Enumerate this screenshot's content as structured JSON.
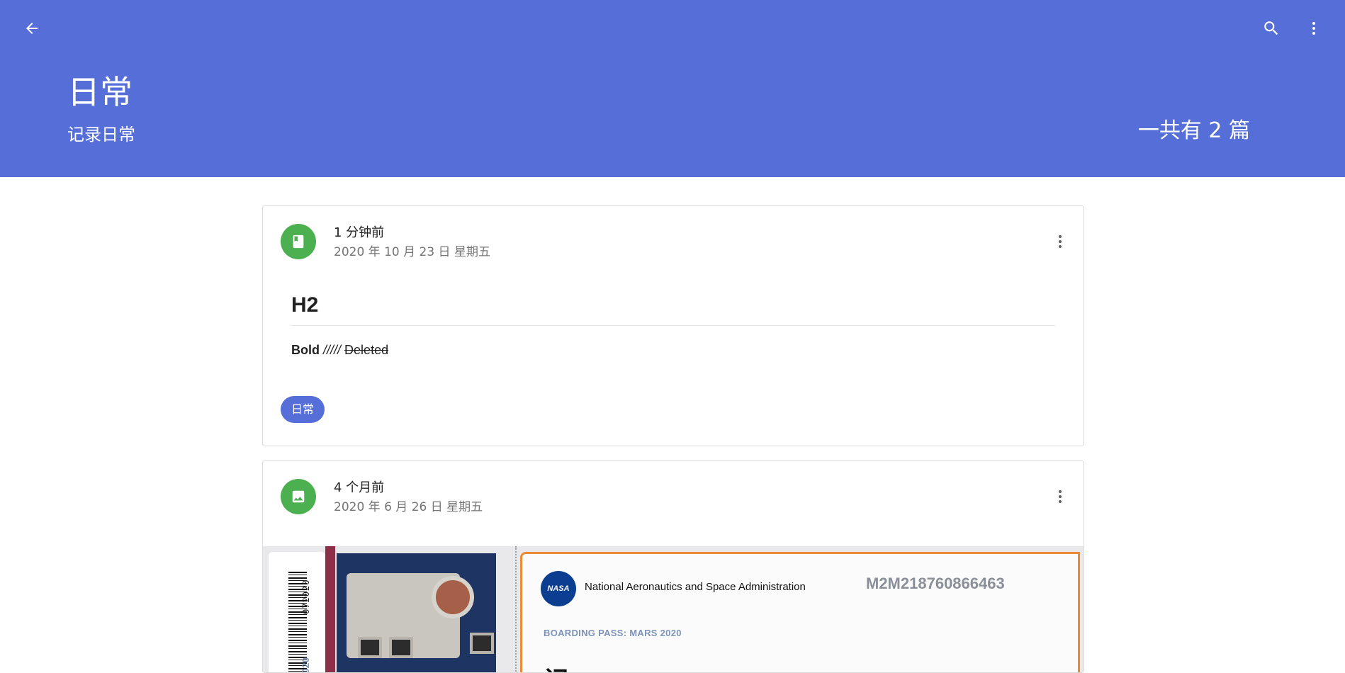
{
  "appbar": {
    "back_icon": "arrow-back-icon",
    "search_icon": "search-icon",
    "more_icon": "more-vert-icon",
    "title": "日常",
    "subtitle": "记录日常",
    "count_label": "一共有 2 篇",
    "color": "#566ed8"
  },
  "posts": [
    {
      "type_icon": "book-icon",
      "relative_time": "1 分钟前",
      "date": "2020 年 10 月 23 日 星期五",
      "heading": "H2",
      "bold_text": "Bold",
      "italic_text": "/////",
      "deleted_text": "Deleted",
      "tag": "日常",
      "avatar_color": "#4caf50"
    },
    {
      "type_icon": "image-icon",
      "relative_time": "4 个月前",
      "date": "2020 年 6 月 26 日 星期五",
      "avatar_color": "#4caf50",
      "image": {
        "stub_number": "072020",
        "stub_year": "2020",
        "agency": "National Aeronautics and Space Administration",
        "logo_text": "NASA",
        "code": "M2M218760866463",
        "label": "BOARDING PASS: MARS 2020",
        "big_text": "记"
      }
    }
  ]
}
